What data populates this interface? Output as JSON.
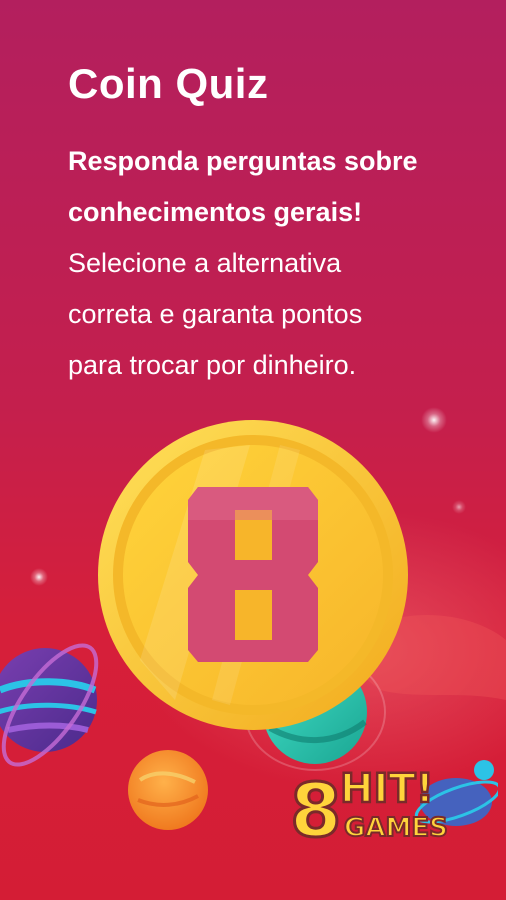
{
  "header": {
    "title": "Coin Quiz"
  },
  "description": {
    "bold_line_1": "Responda perguntas sobre",
    "bold_line_2": "conhecimentos gerais!",
    "line_3": "Selecione a alternativa",
    "line_4": "correta e garanta pontos",
    "line_5": "para trocar por dinheiro."
  },
  "coin": {
    "number": "8",
    "icon": "gold-coin-icon"
  },
  "brand": {
    "logo_text": "8 HIT! GAMES"
  },
  "colors": {
    "background_top": "#b31f5e",
    "background_bottom": "#d41d35",
    "coin_gold": "#f6c22c",
    "coin_number": "#d34a72"
  }
}
